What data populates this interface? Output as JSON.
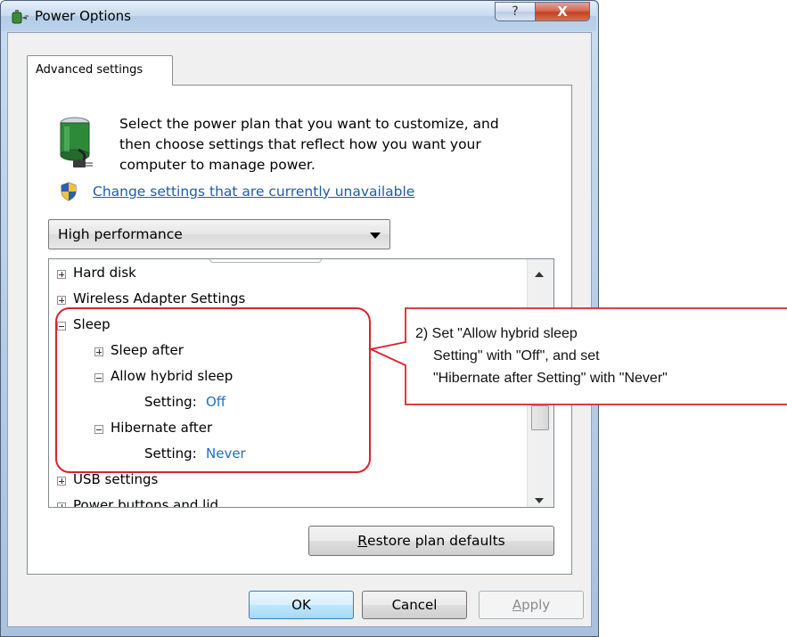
{
  "window": {
    "title": "Power Options",
    "help_symbol": "?",
    "close_symbol": "X",
    "icon": "power-options-icon"
  },
  "tab": {
    "label": "Advanced settings"
  },
  "description": {
    "line1": "Select the power plan that you want to customize, and",
    "line2": "then choose settings that reflect how you want your",
    "line3": "computer to manage power.",
    "icon": "battery-plug-icon"
  },
  "change_link": {
    "label": "Change settings that are currently unavailable",
    "icon": "uac-shield-icon"
  },
  "plan_select": {
    "value": "High performance"
  },
  "tree": {
    "hard_disk": "Hard disk",
    "wireless": "Wireless Adapter Settings",
    "sleep": "Sleep",
    "sleep_after": "Sleep after",
    "allow_hybrid": "Allow hybrid sleep",
    "hybrid_setting_label": "Setting:",
    "hybrid_setting_value": "Off",
    "hibernate_after": "Hibernate after",
    "hibernate_setting_label": "Setting:",
    "hibernate_setting_value": "Never",
    "usb": "USB settings",
    "power_buttons": "Power buttons and lid"
  },
  "buttons": {
    "restore_accel": "R",
    "restore_rest": "estore plan defaults",
    "ok": "OK",
    "cancel": "Cancel",
    "apply_accel": "A",
    "apply_rest": "pply"
  },
  "callout": {
    "line1": "2) Set \"Allow hybrid sleep",
    "line2": "Setting\" with \"Off\", and set",
    "line3": "\"Hibernate after Setting\" with \"Never\"",
    "color": "#d9232e"
  }
}
